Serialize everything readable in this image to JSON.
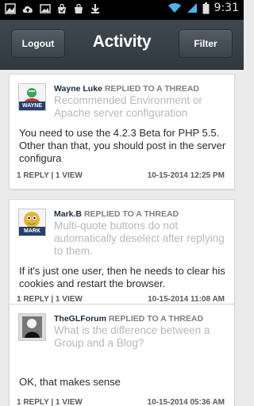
{
  "status_bar": {
    "time": "9:31",
    "icons_left": [
      "photo-icon",
      "cloud-upload-icon",
      "image-icon",
      "bag-icon",
      "shopping-bag-icon",
      "download-icon"
    ],
    "icons_right": [
      "wifi-icon",
      "signal-icon",
      "battery-icon"
    ]
  },
  "header": {
    "title": "Activity",
    "logout_label": "Logout",
    "filter_label": "Filter"
  },
  "feed": [
    {
      "user": "Wayne Luke",
      "action": "REPLIED TO A THREAD",
      "thread_title": "Recommended Environment or Apache server configuration",
      "body": "You need to use the 4.2.3 Beta for PHP 5.5. Other than that, you should post in the server configura",
      "stats": "1 REPLY | 1 VIEW",
      "date": "10-15-2014 12:25 PM",
      "avatar_badge": "WAYNE"
    },
    {
      "user": "Mark.B",
      "action": "REPLIED TO A THREAD",
      "thread_title": "Multi-quote buttons do not automatically deselect after replying to them.",
      "body": "If it's just one user, then he needs to clear his cookies and restart the browser.",
      "stats": "1 REPLY | 1 VIEW",
      "date": "10-15-2014 11:08 AM",
      "avatar_badge": "MARK"
    },
    {
      "user": "TheGLForum",
      "action": "REPLIED TO A THREAD",
      "thread_title": "What is the difference between a Group and a Blog?",
      "body": "OK, that makes sense",
      "stats": "1 REPLY | 1 VIEW",
      "date": "10-15-2014 05:36 AM"
    }
  ],
  "colors": {
    "header_bg": "#363e46",
    "card_bg": "#ffffff",
    "feed_bg": "#ebebeb",
    "username": "#1b2a3a",
    "muted_title": "#b8b8b8"
  }
}
